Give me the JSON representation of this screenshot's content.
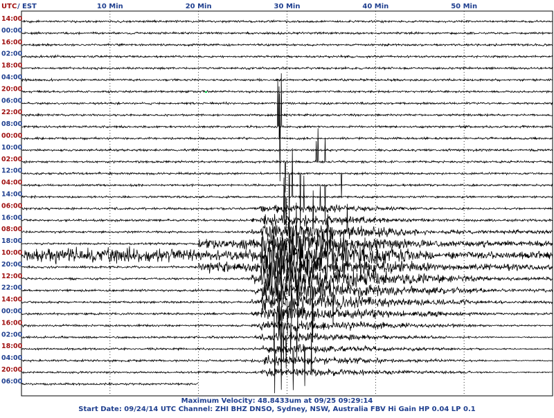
{
  "header": {
    "utc_label": "UTC",
    "separator": "/",
    "est_label": "EST",
    "minute_ticks": [
      "10 Min",
      "20 Min",
      "30 Min",
      "40 Min",
      "50 Min"
    ]
  },
  "footer": {
    "line1": "Maximum Velocity: 48.8433um at 09/25 09:29:14",
    "line2": "Start Date: 09/24/14 UTC Channel: ZHI  BHZ  DNSO, Sydney, NSW, Australia  FBV Hi Gain HP 0.04 LP 0.1"
  },
  "colors": {
    "utc": "#a01010",
    "est": "#1f3f8f",
    "trace": "#000000",
    "grid": "#000000",
    "marker": "#00cc44"
  },
  "chart_data": {
    "type": "line",
    "title": "",
    "x_unit": "minutes",
    "xlim": [
      0,
      60
    ],
    "x_ticks": [
      10,
      20,
      30,
      40,
      50
    ],
    "x_tick_labels": [
      "10 Min",
      "20 Min",
      "30 Min",
      "40 Min",
      "50 Min"
    ],
    "row_count": 32,
    "row_labels": [
      {
        "row": 0,
        "utc": "14:00",
        "est": "00:00"
      },
      {
        "row": 2,
        "utc": "16:00",
        "est": "02:00"
      },
      {
        "row": 4,
        "utc": "18:00",
        "est": "04:00"
      },
      {
        "row": 6,
        "utc": "20:00",
        "est": "06:00"
      },
      {
        "row": 8,
        "utc": "22:00",
        "est": "08:00"
      },
      {
        "row": 10,
        "utc": "00:00",
        "est": "10:00"
      },
      {
        "row": 12,
        "utc": "02:00",
        "est": "12:00"
      },
      {
        "row": 14,
        "utc": "04:00",
        "est": "14:00"
      },
      {
        "row": 16,
        "utc": "06:00",
        "est": "16:00"
      },
      {
        "row": 18,
        "utc": "08:00",
        "est": "18:00"
      },
      {
        "row": 20,
        "utc": "10:00",
        "est": "20:00"
      },
      {
        "row": 22,
        "utc": "12:00",
        "est": "22:00"
      },
      {
        "row": 24,
        "utc": "14:00",
        "est": "00:00"
      },
      {
        "row": 26,
        "utc": "16:00",
        "est": "02:00"
      },
      {
        "row": 28,
        "utc": "18:00",
        "est": "04:00"
      },
      {
        "row": 30,
        "utc": "20:00",
        "est": "06:00"
      }
    ],
    "last_row_end_minute": 20,
    "max_velocity_um": 48.8433,
    "max_velocity_time": "09/25 09:29:14",
    "event": {
      "start_row": 16,
      "end_row": 30,
      "start_minute": 26,
      "peak_minute": 29.5
    }
  }
}
